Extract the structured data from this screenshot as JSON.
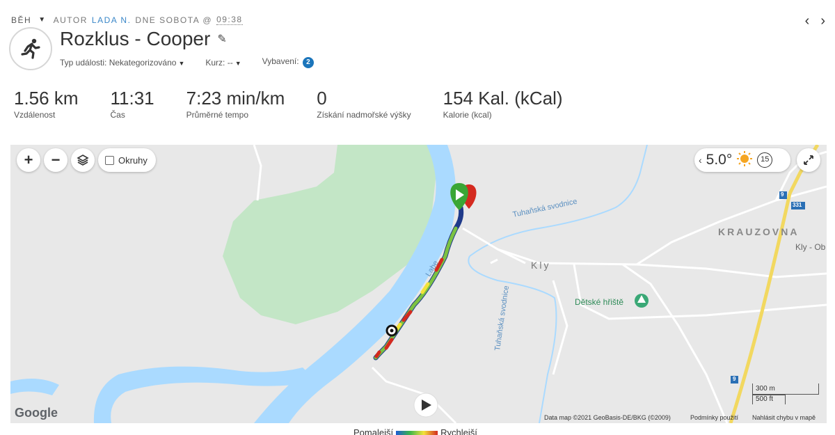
{
  "header": {
    "sport": "BĚH",
    "author_prefix": "AUTOR",
    "author_name": "LADA N.",
    "day_prefix": "DNE SOBOTA @",
    "time": "09:38",
    "title": "Rozklus - Cooper",
    "event_type_label": "Typ události:",
    "event_type_value": "Nekategorizováno",
    "course_label": "Kurz:",
    "course_value": "--",
    "gear_label": "Vybavení:",
    "gear_count": "2"
  },
  "stats": [
    {
      "value": "1.56 km",
      "label": "Vzdálenost"
    },
    {
      "value": "11:31",
      "label": "Čas"
    },
    {
      "value": "7:23 min/km",
      "label": "Průměrné tempo"
    },
    {
      "value": "0",
      "label": "Získání nadmořské výšky"
    },
    {
      "value": "154 Kal. (kCal)",
      "label": "Kalorie (kcal)"
    }
  ],
  "map": {
    "okruhy_label": "Okruhy",
    "temperature": "5.0°",
    "wind_speed": "15",
    "labels": {
      "river": "Labe",
      "canal_1": "Tuhaňská svodnice",
      "canal_2": "Tuhaňská svodnice",
      "village": "Kly",
      "district": "KRAUZOVNA",
      "kly_ob": "Kly - Ob",
      "playground": "Dětské hřiště",
      "road_9_a": "9",
      "road_331": "331",
      "road_9_b": "9"
    },
    "scale": {
      "metric": "300 m",
      "imperial": "500 ft"
    },
    "google_logo": "Google",
    "attribution": "Data map ©2021 GeoBasis-DE/BKG (©2009)",
    "terms": "Podmínky použití",
    "report": "Nahlásit chybu v mapě"
  },
  "legend": {
    "slower": "Pomalejší",
    "faster": "Rychlejší"
  },
  "colors": {
    "accent": "#1b75bb",
    "water": "#aadaff",
    "forest": "#c3e6c6",
    "start_pin": "#3aa635",
    "road_yellow": "#f2d860"
  }
}
